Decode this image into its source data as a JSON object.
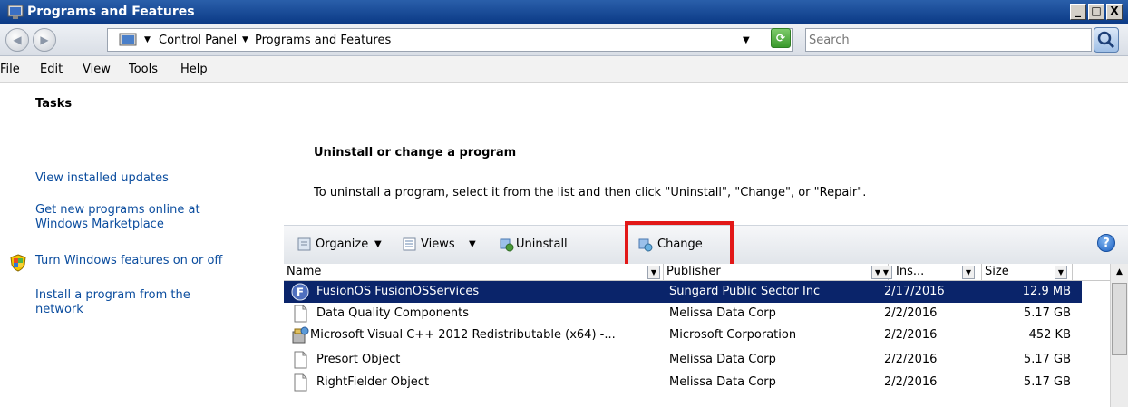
{
  "window": {
    "title": "Programs and Features",
    "buttons": {
      "minimize": "_",
      "maximize": "□",
      "close": "X"
    }
  },
  "address_bar": {
    "back": "◀",
    "forward": "▶",
    "breadcrumbs": [
      "Control Panel",
      "Programs and Features"
    ],
    "search_placeholder": "Search"
  },
  "menu": [
    "File",
    "Edit",
    "View",
    "Tools",
    "Help"
  ],
  "tasks": {
    "heading": "Tasks",
    "links": [
      "View installed updates",
      "Get new programs online at",
      "Windows Marketplace",
      "Turn Windows features on or off",
      "Install a program from the",
      "network"
    ]
  },
  "main": {
    "heading": "Uninstall or change a program",
    "description": "To uninstall a program, select it from the list and then click \"Uninstall\", \"Change\", or \"Repair\"."
  },
  "toolbar": {
    "organize": "Organize",
    "views": "Views",
    "uninstall": "Uninstall",
    "change": "Change",
    "help": "?"
  },
  "list": {
    "columns": [
      "Name",
      "Publisher",
      "Ins...",
      "Size"
    ],
    "rows": [
      {
        "name": "FusionOS FusionOSServices",
        "publisher": "Sungard Public Sector Inc",
        "installed": "2/17/2016",
        "size": "12.9 MB",
        "icon": "fusion-app-icon"
      },
      {
        "name": "Data Quality Components",
        "publisher": "Melissa Data Corp",
        "installed": "2/2/2016",
        "size": "5.17 GB",
        "icon": "document-icon"
      },
      {
        "name": "Microsoft Visual C++ 2012 Redistributable (x64) -...",
        "publisher": "Microsoft Corporation",
        "installed": "2/2/2016",
        "size": "452 KB",
        "icon": "installer-icon"
      },
      {
        "name": "Presort Object",
        "publisher": "Melissa Data Corp",
        "installed": "2/2/2016",
        "size": "5.17 GB",
        "icon": "document-icon"
      },
      {
        "name": "RightFielder Object",
        "publisher": "Melissa Data Corp",
        "installed": "2/2/2016",
        "size": "5.17 GB",
        "icon": "document-icon"
      }
    ],
    "selected_index": 0
  },
  "colors": {
    "highlight_box": "#e21818",
    "link": "#0a4c9e",
    "selection": "#0a246a"
  }
}
